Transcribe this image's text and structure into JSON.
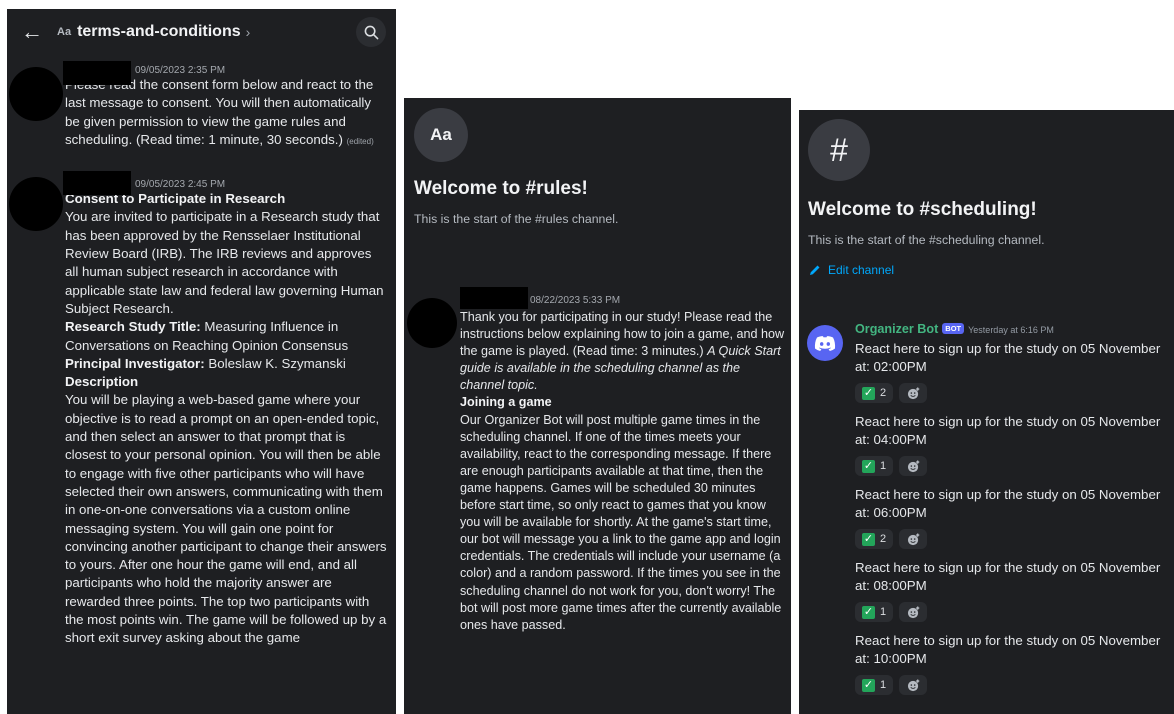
{
  "panel1": {
    "header": {
      "back": "←",
      "aa": "Aa",
      "channel": "terms-and-conditions",
      "chevron": "›"
    },
    "messages": [
      {
        "timestamp": "09/05/2023 2:35 PM",
        "text": "Please read the consent form below and react to the last message to consent. You will then automatically be given permission to view the game rules and scheduling. (Read time: 1 minute, 30 seconds.)",
        "edited": "(edited)"
      },
      {
        "timestamp": "09/05/2023 2:45 PM",
        "heading": "Consent to Participate in Research",
        "intro": "You are invited to participate in a Research study that has been approved by the Rensselaer Institutional Review Board (IRB). The IRB reviews and approves all human subject research in accordance with applicable state law and federal law governing Human Subject Research.",
        "title_label": "Research Study Title:",
        "title_value": " Measuring Influence in Conversations on Reaching Opinion Consensus",
        "pi_label": "Principal Investigator:",
        "pi_value": " Boleslaw K. Szymanski",
        "desc_label": "Description",
        "desc_text": "You will be playing a web-based game where your objective is to read a prompt on an open-ended topic, and then select an answer to that prompt that is closest to your personal opinion. You will then be able to engage with five other participants who will have selected their own answers, communicating with them in one-on-one conversations via a custom online messaging system. You will gain one point for convincing another participant to change their answers to yours. After one hour the game will end, and all participants who hold the majority answer are rewarded three points. The top two participants with the most points win. The game will be followed up by a short exit survey asking about the game"
      }
    ]
  },
  "panel2": {
    "icon_text": "Aa",
    "welcome": "Welcome to #rules!",
    "start": "This is the start of the #rules channel.",
    "message": {
      "timestamp": "08/22/2023 5:33 PM",
      "p1": "Thank you for participating in our study! Please read the instructions below explaining how to join a game, and how the game is played. (Read time: 3 minutes.) ",
      "p1_italic": "A Quick Start guide is available in the scheduling channel as the channel topic.",
      "heading": "Joining a game",
      "p2": "Our Organizer Bot will post multiple game times in the scheduling channel. If one of the times meets your availability, react to the corresponding message. If there are enough participants available at that time, then the game happens. Games will be scheduled 30 minutes before start time, so only react to games that you know you will be available for shortly. At the game's start time, our bot will message you a link to the game app and login credentials. The credentials will include your username (a color) and a random password. If the times you see in the scheduling channel do not work for you, don't worry! The bot will post more game times after the currently available ones have passed."
    }
  },
  "panel3": {
    "icon_text": "#",
    "welcome": "Welcome to #scheduling!",
    "start": "This is the start of the #scheduling channel.",
    "edit": "Edit channel",
    "bot": {
      "name": "Organizer Bot",
      "badge": "BOT",
      "time": "Yesterday at 6:16 PM"
    },
    "slots": [
      {
        "line1": "React here to sign up for the study on 05 November",
        "line2": "at: 02:00PM",
        "count": "2"
      },
      {
        "line1": "React here to sign up for the study on 05 November",
        "line2": "at: 04:00PM",
        "count": "1"
      },
      {
        "line1": "React here to sign up for the study on 05 November",
        "line2": "at: 06:00PM",
        "count": "2"
      },
      {
        "line1": "React here to sign up for the study on 05 November",
        "line2": "at: 08:00PM",
        "count": "1"
      },
      {
        "line1": "React here to sign up for the study on 05 November",
        "line2": "at: 10:00PM",
        "count": "1"
      }
    ],
    "colors": {
      "accent": "#5865f2",
      "bot_name": "#43b581",
      "check": "#23a55a",
      "link": "#00a8fc"
    }
  }
}
